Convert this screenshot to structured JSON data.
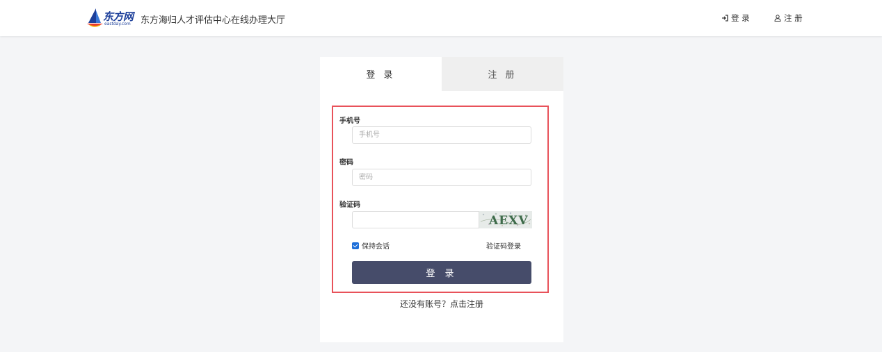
{
  "header": {
    "logo_text": "东方网",
    "logo_sub": "eastday.com",
    "site_title": "东方海归人才评估中心在线办理大厅",
    "login_icon": "sign-in-icon",
    "login_label": "登 录",
    "register_icon": "user-icon",
    "register_label": "注 册"
  },
  "tabs": [
    {
      "label": "登 录",
      "active": true
    },
    {
      "label": "注 册",
      "active": false
    }
  ],
  "form": {
    "phone_label": "手机号",
    "phone_placeholder": "手机号",
    "password_label": "密码",
    "password_placeholder": "密码",
    "captcha_label": "验证码",
    "captcha_text": "AEXV",
    "remember_label": "保持会话",
    "remember_checked": true,
    "code_login_label": "验证码登录",
    "submit_label": "登 录",
    "register_prompt": "还没有账号？点击注册"
  },
  "colors": {
    "highlight_border": "#e8525a",
    "submit_bg": "#464c6a",
    "checkbox": "#1e6fd9",
    "logo_blue": "#1d3f9a"
  }
}
